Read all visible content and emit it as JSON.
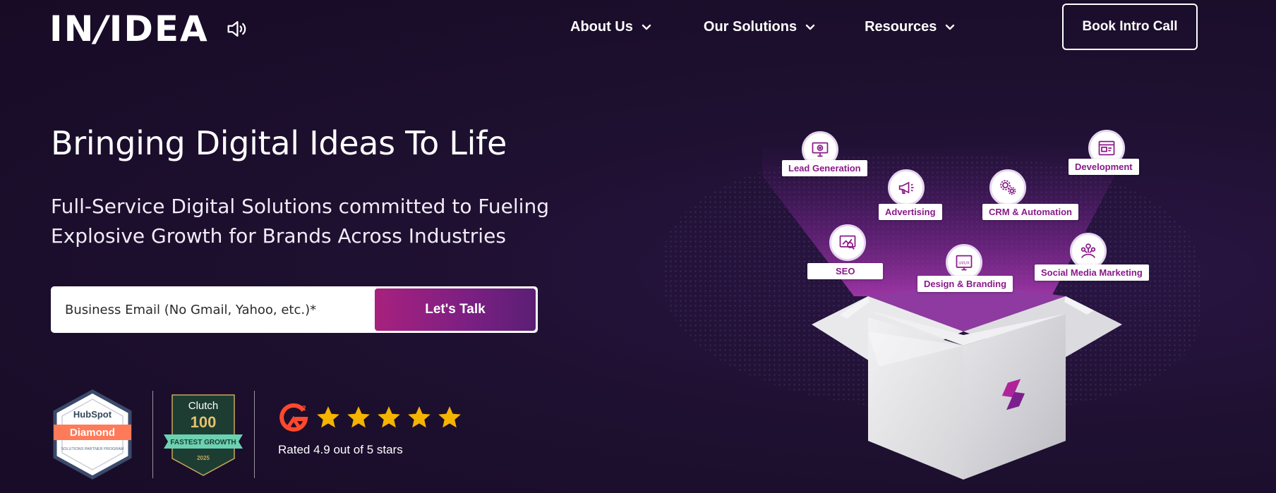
{
  "header": {
    "logo": "INSIDEA",
    "nav": [
      {
        "label": "About Us"
      },
      {
        "label": "Our Solutions"
      },
      {
        "label": "Resources"
      }
    ],
    "cta_label": "Book Intro Call"
  },
  "hero": {
    "title": "Bringing Digital Ideas To Life",
    "subtitle": "Full-Service Digital Solutions committed to Fueling Explosive Growth for Brands Across Industries",
    "email_placeholder": "Business Email (No Gmail, Yahoo, etc.)*",
    "submit_label": "Let's Talk"
  },
  "badges": {
    "hubspot": {
      "brand": "HubSpot",
      "tier": "Diamond",
      "caption": "SOLUTIONS PARTNER PROGRAM"
    },
    "clutch": {
      "brand": "Clutch",
      "number": "100",
      "ribbon": "FASTEST GROWTH",
      "year": "2025"
    },
    "g2": {
      "logo": "G2",
      "stars": 5,
      "rated_text": "Rated 4.9 out of 5 stars"
    }
  },
  "services": [
    {
      "label": "Lead Generation",
      "icon": "monitor-target-icon"
    },
    {
      "label": "Development",
      "icon": "browser-code-icon"
    },
    {
      "label": "Advertising",
      "icon": "megaphone-icon"
    },
    {
      "label": "CRM & Automation",
      "icon": "gears-icon"
    },
    {
      "label": "SEO",
      "icon": "analytics-icon"
    },
    {
      "label": "Design & Branding",
      "icon": "ui-ux-icon"
    },
    {
      "label": "Social Media Marketing",
      "icon": "social-network-icon"
    }
  ],
  "colors": {
    "background": "#1e1030",
    "accent_magenta": "#a8217e",
    "accent_purple": "#5b1f74",
    "star": "#f5b400"
  }
}
